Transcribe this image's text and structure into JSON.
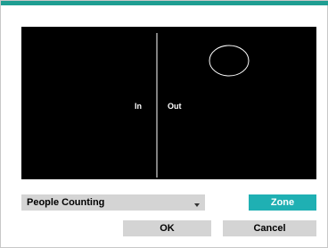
{
  "canvas": {
    "in_label": "In",
    "out_label": "Out"
  },
  "controls": {
    "mode_select": {
      "selected": "People Counting"
    },
    "zone_button_label": "Zone",
    "ok_button_label": "OK",
    "cancel_button_label": "Cancel"
  },
  "colors": {
    "accent": "#1f9e92",
    "zone_button": "#1fb0b3",
    "canvas_background": "#000000",
    "button_gray": "#d4d4d4"
  },
  "icons": {
    "dropdown": "chevron-down-icon"
  }
}
